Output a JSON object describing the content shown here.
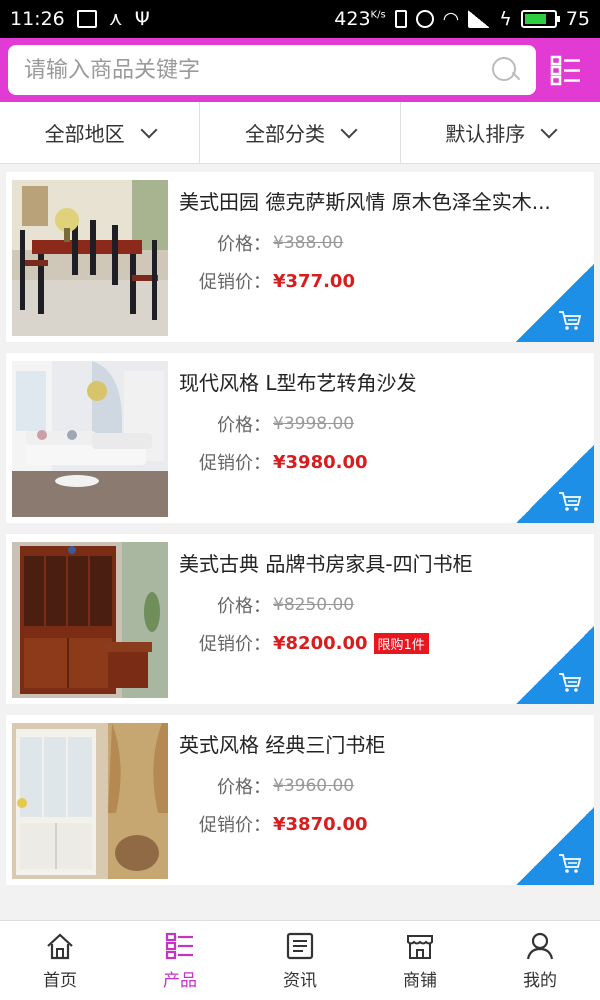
{
  "status_bar": {
    "time": "11:26",
    "speed": "423",
    "speed_unit": "K/s",
    "battery": "75",
    "battery_fraction": 0.75
  },
  "search": {
    "placeholder": "请输入商品关键字"
  },
  "filters": [
    {
      "label": "全部地区"
    },
    {
      "label": "全部分类"
    },
    {
      "label": "默认排序"
    }
  ],
  "labels": {
    "price": "价格：",
    "promo_price": "促销价："
  },
  "products": [
    {
      "title": "美式田园 德克萨斯风情 原木色泽全实木...",
      "price": "¥388.00",
      "promo_price": "¥377.00",
      "badge": ""
    },
    {
      "title": "现代风格 L型布艺转角沙发",
      "price": "¥3998.00",
      "promo_price": "¥3980.00",
      "badge": ""
    },
    {
      "title": "美式古典 品牌书房家具-四门书柜",
      "price": "¥8250.00",
      "promo_price": "¥8200.00",
      "badge": "限购1件"
    },
    {
      "title": "英式风格 经典三门书柜",
      "price": "¥3960.00",
      "promo_price": "¥3870.00",
      "badge": ""
    }
  ],
  "nav": [
    {
      "label": "首页",
      "icon": "home-icon"
    },
    {
      "label": "产品",
      "icon": "product-grid-icon"
    },
    {
      "label": "资讯",
      "icon": "news-icon"
    },
    {
      "label": "商铺",
      "icon": "shop-icon"
    },
    {
      "label": "我的",
      "icon": "user-icon"
    }
  ],
  "colors": {
    "brand": "#e23bd3",
    "accent_blue": "#1e8fe6",
    "price_red": "#d71d1d",
    "active_nav": "#c532c5"
  }
}
